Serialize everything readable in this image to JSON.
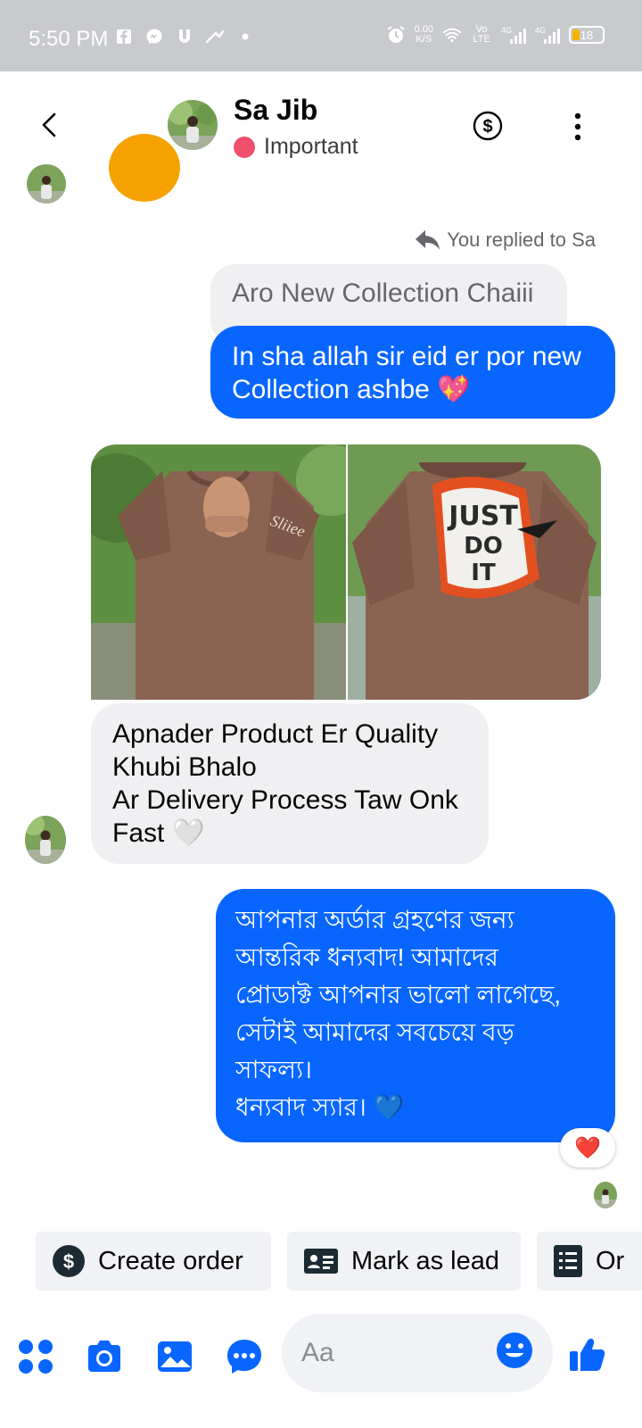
{
  "status_bar": {
    "time": "5:50 PM",
    "speed_value": "0.00",
    "speed_unit": "K/S",
    "network_1": "Vo LTE",
    "network_2": "4G",
    "network_3": "4G",
    "battery": "18"
  },
  "header": {
    "contact_name": "Sa Jib",
    "label": "Important",
    "label_color": "#f0506e"
  },
  "chat": {
    "reply_note": "You replied to Sa",
    "quoted_message": "Aro New Collection Chaiii",
    "outgoing_1_line1": "In sha allah sir eid er por new",
    "outgoing_1_line2": "Collection ashbe 💖",
    "incoming_1_line1": "Apnader Product Er Quality",
    "incoming_1_line2": "Khubi Bhalo",
    "incoming_1_line3": "Ar Delivery Process Taw Onk",
    "incoming_1_line4": "Fast 🤍",
    "outgoing_2_line1": "আপনার অর্ডার গ্রহণের জন্য",
    "outgoing_2_line2": "আন্তরিক ধন্যবাদ! আমাদের",
    "outgoing_2_line3": "প্রোডাক্ট আপনার ভালো লাগেছে,",
    "outgoing_2_line4": "সেটাই আমাদের সবচেয়ে বড়",
    "outgoing_2_line5": "সাফল্য।",
    "outgoing_2_line6": "ধন্যবাদ স্যার। 💙",
    "photo_1_text": "Sliiee",
    "photo_2_text_1": "JUST",
    "photo_2_text_2": "DO",
    "photo_2_text_3": "IT",
    "reaction": "❤️"
  },
  "quick_actions": {
    "create_order": "Create order",
    "mark_as_lead": "Mark as lead",
    "orders": "Or"
  },
  "composer": {
    "placeholder": "Aa"
  },
  "colors": {
    "accent": "#0866ff",
    "incoming_bubble": "#f0f0f2",
    "status_bar_bg": "#c8cacd"
  }
}
